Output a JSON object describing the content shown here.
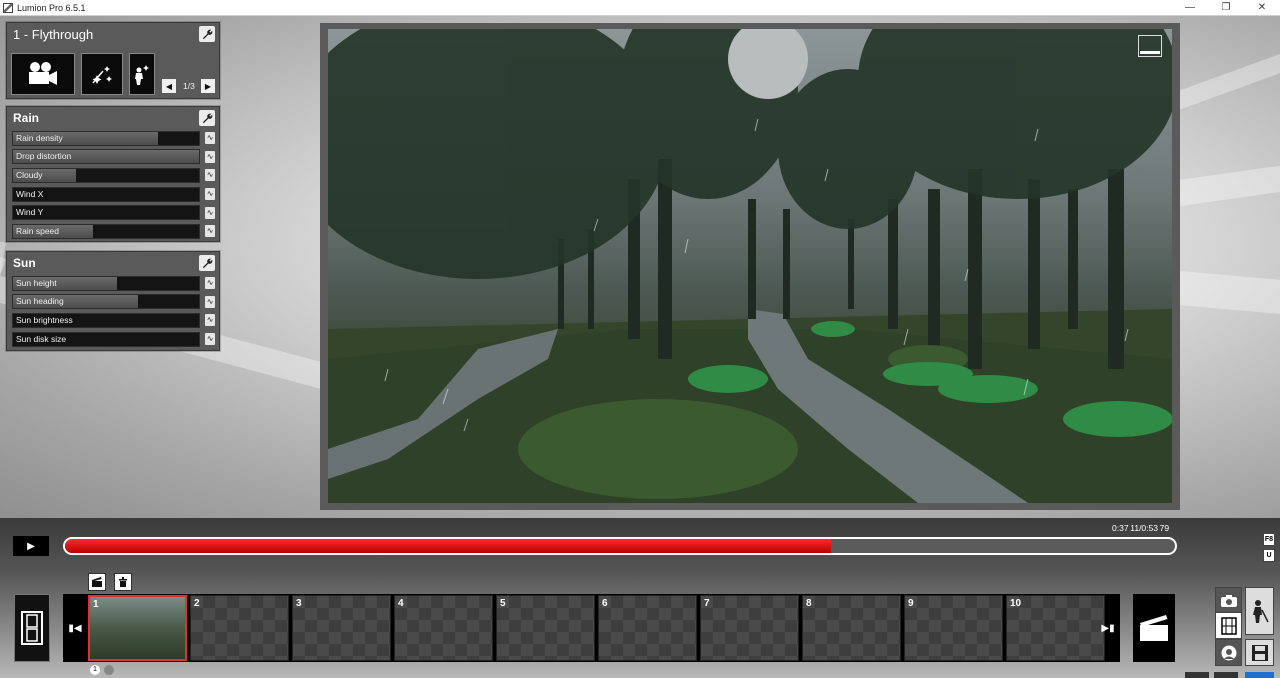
{
  "window": {
    "title": "Lumion Pro 6.5.1"
  },
  "fx_panel": {
    "title": "1 - Flythrough",
    "page_indicator": "1/3"
  },
  "rain_panel": {
    "title": "Rain",
    "sliders": [
      {
        "label": "Rain density",
        "level": 0.78
      },
      {
        "label": "Drop distortion",
        "level": 1.0
      },
      {
        "label": "Cloudy",
        "level": 0.34
      },
      {
        "label": "Wind X",
        "level": 0.0
      },
      {
        "label": "Wind Y",
        "level": 0.0
      },
      {
        "label": "Rain speed",
        "level": 0.43
      }
    ]
  },
  "sun_panel": {
    "title": "Sun",
    "sliders": [
      {
        "label": "Sun height",
        "level": 0.56
      },
      {
        "label": "Sun heading",
        "level": 0.67
      },
      {
        "label": "Sun brightness",
        "level": 0.0
      },
      {
        "label": "Sun disk size",
        "level": 0.0
      }
    ]
  },
  "timeline": {
    "timecode": "0:37 11/0:53 79",
    "progress": 0.69,
    "side_keys": [
      "F8",
      "U"
    ]
  },
  "clips": [
    {
      "number": "1",
      "active": true
    },
    {
      "number": "2",
      "active": false
    },
    {
      "number": "3",
      "active": false
    },
    {
      "number": "4",
      "active": false
    },
    {
      "number": "5",
      "active": false
    },
    {
      "number": "6",
      "active": false
    },
    {
      "number": "7",
      "active": false
    },
    {
      "number": "8",
      "active": false
    },
    {
      "number": "9",
      "active": false
    },
    {
      "number": "10",
      "active": false
    }
  ],
  "strip_page": "1",
  "colors": {
    "progress_red": "#d00000",
    "panel_bg": "#5a5a5a",
    "active_clip_border": "#dd3333"
  }
}
